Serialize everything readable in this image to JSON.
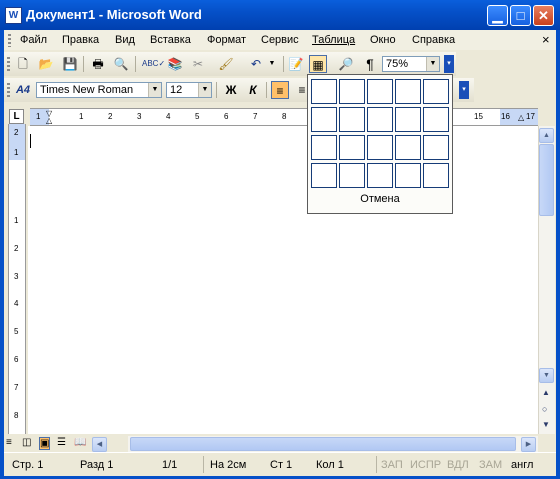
{
  "window": {
    "title": "Документ1 - Microsoft Word",
    "app_icon": "W"
  },
  "menu": {
    "items": [
      {
        "label": "Файл"
      },
      {
        "label": "Правка"
      },
      {
        "label": "Вид"
      },
      {
        "label": "Вставка"
      },
      {
        "label": "Формат"
      },
      {
        "label": "Сервис"
      },
      {
        "label": "Таблица"
      },
      {
        "label": "Окно"
      },
      {
        "label": "Справка"
      }
    ],
    "close_glyph": "×"
  },
  "standard_toolbar": {
    "zoom": "75%"
  },
  "formatting_toolbar": {
    "font": "Times New Roman",
    "size": "12",
    "bold": "Ж",
    "italic": "К",
    "style_icon": "A4"
  },
  "ruler": {
    "h_labels": [
      "1",
      "1",
      "2",
      "3",
      "4",
      "5",
      "6",
      "7",
      "8",
      "15",
      "16",
      "17"
    ],
    "v_labels": [
      "2",
      "1",
      "1",
      "2",
      "3",
      "4",
      "5",
      "6",
      "7",
      "8"
    ]
  },
  "table_picker": {
    "rows": 4,
    "cols": 5,
    "cancel_label": "Отмена"
  },
  "status": {
    "page": "Стр. 1",
    "section": "Разд  1",
    "count": "1/1",
    "at": "На  2см",
    "line": "Ст  1",
    "col": "Кол  1",
    "rec": "ЗАП",
    "trk": "ИСПР",
    "ext": "ВДЛ",
    "ovr": "ЗАМ",
    "lang": "англ"
  }
}
